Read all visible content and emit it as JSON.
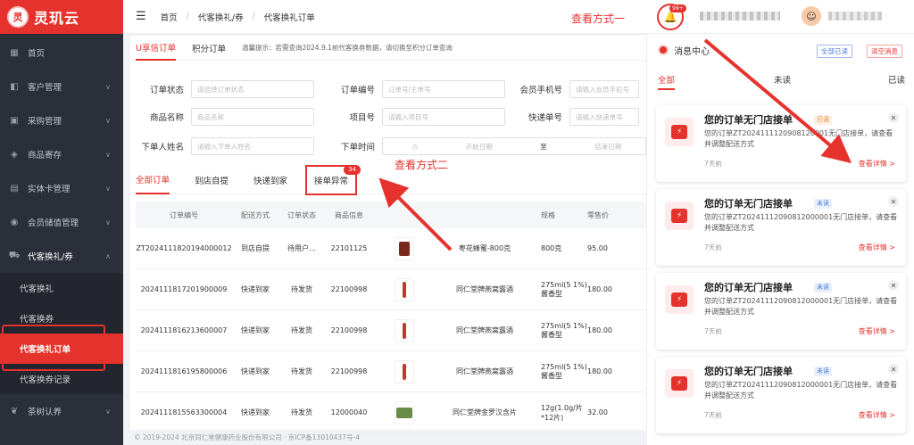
{
  "sidebar": {
    "logo_badge": "灵",
    "logo_text": "灵玑云",
    "items": [
      {
        "label": "首页",
        "icon": "grid-icon",
        "chev": ""
      },
      {
        "label": "客户管理",
        "icon": "user-icon",
        "chev": "∨"
      },
      {
        "label": "采购管理",
        "icon": "cart-icon",
        "chev": "∨"
      },
      {
        "label": "商品寄存",
        "icon": "box-icon",
        "chev": "∨"
      },
      {
        "label": "实体卡管理",
        "icon": "card-icon",
        "chev": "∨"
      },
      {
        "label": "会员储值管理",
        "icon": "wallet-icon",
        "chev": "∨"
      },
      {
        "label": "代客换礼/券",
        "icon": "shopping-cart-icon",
        "chev": "∧"
      }
    ],
    "submenu": [
      {
        "label": "代客换礼"
      },
      {
        "label": "代客换券"
      },
      {
        "label": "代客换礼订单"
      },
      {
        "label": "代客换券记录"
      }
    ],
    "bottom_item": {
      "label": "茶树认养",
      "chev": "∨"
    }
  },
  "topbar": {
    "breadcrumb": [
      "首页",
      "代客换礼/券",
      "代客换礼订单"
    ],
    "annotation": "查看方式一",
    "bell_badge": "99+"
  },
  "main": {
    "tabs": [
      "U享信订单",
      "积分订单"
    ],
    "tip": "温馨提示：若需查询2024.9.1前代客换券数据，请切换至积分订单查询",
    "filters": {
      "order_status_label": "订单状态",
      "order_status_ph": "请选择订单状态",
      "order_no_label": "订单编号",
      "order_no_ph": "订单号/主单号",
      "phone_label": "会员手机号",
      "phone_ph": "请输入会员手机号",
      "goods_label": "商品名称",
      "goods_ph": "商品名称",
      "item_label": "项目号",
      "item_ph": "请输入项目号",
      "express_label": "快递单号",
      "express_ph": "请输入快递单号",
      "orderer_label": "下单人姓名",
      "orderer_ph": "请输入下单人姓名",
      "time_label": "下单时间",
      "start_ph": "开始日期",
      "to": "至",
      "end_ph": "结束日期"
    },
    "order_tabs": [
      "全部订单",
      "到店自提",
      "快递到家",
      "接单异常"
    ],
    "exception_count": "34",
    "annotation": "查看方式二",
    "columns": [
      "订单编号",
      "配送方式",
      "订单状态",
      "商品信息",
      "",
      "",
      "规格",
      "零售价"
    ],
    "rows": [
      {
        "no": "ZT2024111820194000012",
        "ship": "到店自提",
        "status": "待用户…",
        "code": "22101125",
        "thumb": "jar",
        "name": "枣花蜂蜜-800克",
        "spec": "800克",
        "price": "95.00"
      },
      {
        "no": "2024111817201900009",
        "ship": "快递到家",
        "status": "待发货",
        "code": "22100998",
        "thumb": "bottle",
        "name": "同仁堂牌燕窝露酒",
        "spec": "275ml(5 1%)酱香型",
        "price": "180.00"
      },
      {
        "no": "2024111816213600007",
        "ship": "快递到家",
        "status": "待发货",
        "code": "22100998",
        "thumb": "bottle",
        "name": "同仁堂牌燕窝露酒",
        "spec": "275ml(5 1%)酱香型",
        "price": "180.00"
      },
      {
        "no": "2024111816195800006",
        "ship": "快递到家",
        "status": "待发货",
        "code": "22100998",
        "thumb": "bottle",
        "name": "同仁堂牌燕窝露酒",
        "spec": "275ml(5 1%)酱香型",
        "price": "180.00"
      },
      {
        "no": "2024111815563300004",
        "ship": "快递到家",
        "status": "待发货",
        "code": "12000040",
        "thumb": "pack",
        "name": "同仁堂牌金罗汉含片",
        "spec": "12g(1.0g/片*12片)",
        "price": "32.00"
      }
    ]
  },
  "footer": "© 2019-2024 北京同仁堂健康药业股份有限公司 · 京ICP备13010437号-4",
  "panel": {
    "title": "消息中心",
    "mark_all_read": "全部已读",
    "clear": "清空消息",
    "tabs": [
      "全部",
      "未读",
      "已读"
    ],
    "cards": [
      {
        "title": "您的订单无门店接单",
        "tag": "已读",
        "tag_type": "read",
        "body": "您的订单ZT2024111120908120001无门店接单，请查看并调整配送方式",
        "time": "7天前",
        "link": "查看详情 >"
      },
      {
        "title": "您的订单无门店接单",
        "tag": "未读",
        "tag_type": "unread",
        "body": "您的订单ZT20241112090812000001无门店接单，请查看并调整配送方式",
        "time": "7天前",
        "link": "查看详情 >"
      },
      {
        "title": "您的订单无门店接单",
        "tag": "未读",
        "tag_type": "unread",
        "body": "您的订单ZT20241112090812000001无门店接单，请查看并调整配送方式",
        "time": "7天前",
        "link": "查看详情 >"
      },
      {
        "title": "您的订单无门店接单",
        "tag": "未读",
        "tag_type": "unread",
        "body": "您的订单ZT20241112090812000001无门店接单，请查看并调整配送方式",
        "time": "7天前",
        "link": "查看详情 >"
      }
    ]
  },
  "colors": {
    "brand": "#e5322c",
    "sidebar": "#2b2f3a"
  }
}
